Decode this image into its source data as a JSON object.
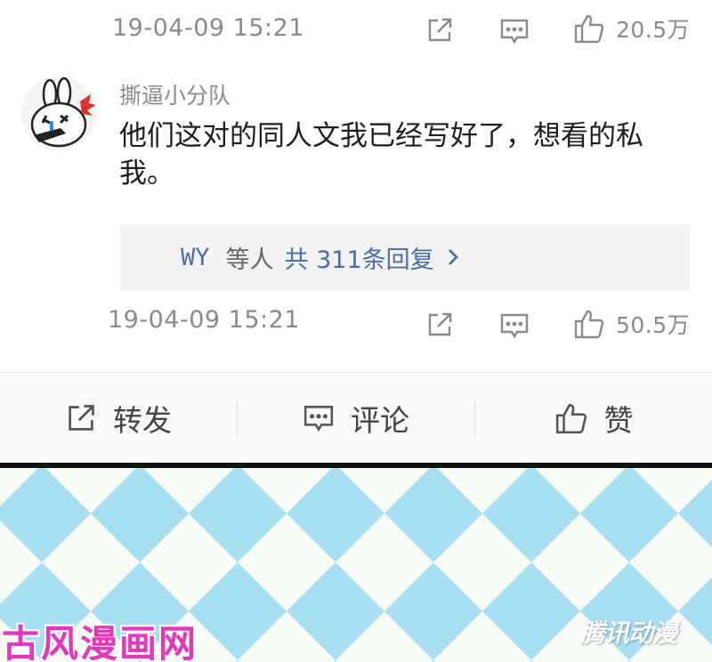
{
  "comment_prev": {
    "timestamp": "19-04-09 15:21",
    "like_count": "20.5万",
    "icons": {
      "share": "share-icon",
      "comment": "comment-icon",
      "like": "thumbs-up-icon"
    }
  },
  "comment": {
    "username": "撕逼小分队",
    "avatar": "rabbit-avatar",
    "text": "他们这对的同人文我已经写好了，想看的私我。",
    "replies": {
      "user": "WY",
      "middle": "等人",
      "link": "共 311条回复"
    },
    "timestamp": "19-04-09 15:21",
    "like_count": "50.5万"
  },
  "bottom_bar": {
    "share_label": "转发",
    "comment_label": "评论",
    "like_label": "赞"
  },
  "watermarks": {
    "left": "古风漫画网",
    "right": "腾讯动漫"
  },
  "colors": {
    "link": "#4a6fa1",
    "meta_text": "#8a8a8a",
    "pattern_blue": "#a9dff3",
    "watermark_pink": "#e238b9"
  }
}
